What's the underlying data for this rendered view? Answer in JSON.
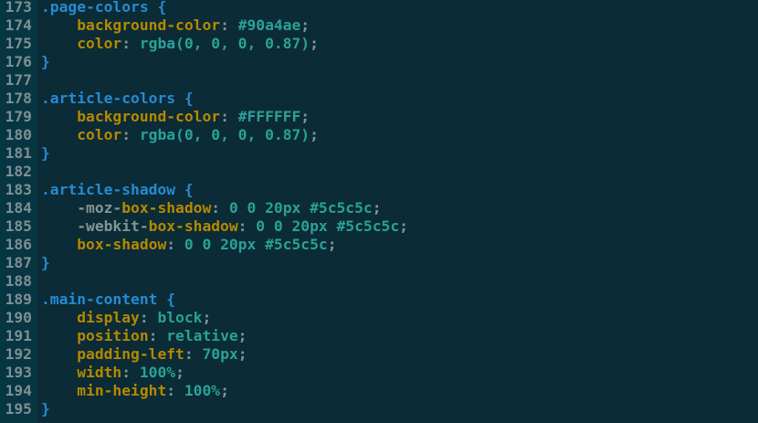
{
  "colors": {
    "background": "#0b2b36",
    "gutter": "#073642",
    "line_number": "#7f8f92",
    "selector": "#268bd2",
    "property": "#b58900",
    "value": "#2aa198",
    "punctuation": "#839496"
  },
  "editor": {
    "lines": [
      {
        "n": "173",
        "tokens": [
          {
            "t": "sel",
            "v": ".page-colors"
          },
          {
            "t": "brace",
            "v": " {"
          }
        ]
      },
      {
        "n": "174",
        "tokens": [
          {
            "t": "ind",
            "v": "    "
          },
          {
            "t": "prop",
            "v": "background-color"
          },
          {
            "t": "punct",
            "v": ": "
          },
          {
            "t": "val",
            "v": "#90a4ae"
          },
          {
            "t": "punct",
            "v": ";"
          }
        ]
      },
      {
        "n": "175",
        "tokens": [
          {
            "t": "ind",
            "v": "    "
          },
          {
            "t": "prop",
            "v": "color"
          },
          {
            "t": "punct",
            "v": ": "
          },
          {
            "t": "val",
            "v": "rgba(0, 0, 0, 0.87)"
          },
          {
            "t": "punct",
            "v": ";"
          }
        ]
      },
      {
        "n": "176",
        "tokens": [
          {
            "t": "brace",
            "v": "}"
          }
        ]
      },
      {
        "n": "177",
        "tokens": []
      },
      {
        "n": "178",
        "tokens": [
          {
            "t": "sel",
            "v": ".article-colors"
          },
          {
            "t": "brace",
            "v": " {"
          }
        ]
      },
      {
        "n": "179",
        "tokens": [
          {
            "t": "ind",
            "v": "    "
          },
          {
            "t": "prop",
            "v": "background-color"
          },
          {
            "t": "punct",
            "v": ": "
          },
          {
            "t": "val",
            "v": "#FFFFFF"
          },
          {
            "t": "punct",
            "v": ";"
          }
        ]
      },
      {
        "n": "180",
        "tokens": [
          {
            "t": "ind",
            "v": "    "
          },
          {
            "t": "prop",
            "v": "color"
          },
          {
            "t": "punct",
            "v": ": "
          },
          {
            "t": "val",
            "v": "rgba(0, 0, 0, 0.87)"
          },
          {
            "t": "punct",
            "v": ";"
          }
        ]
      },
      {
        "n": "181",
        "tokens": [
          {
            "t": "brace",
            "v": "}"
          }
        ]
      },
      {
        "n": "182",
        "tokens": []
      },
      {
        "n": "183",
        "tokens": [
          {
            "t": "sel",
            "v": ".article-shadow"
          },
          {
            "t": "brace",
            "v": " {"
          }
        ]
      },
      {
        "n": "184",
        "tokens": [
          {
            "t": "ind",
            "v": "    "
          },
          {
            "t": "vend",
            "v": "-moz-"
          },
          {
            "t": "prop",
            "v": "box-shadow"
          },
          {
            "t": "punct",
            "v": ": "
          },
          {
            "t": "val",
            "v": "0 0 20px #5c5c5c"
          },
          {
            "t": "punct",
            "v": ";"
          }
        ]
      },
      {
        "n": "185",
        "tokens": [
          {
            "t": "ind",
            "v": "    "
          },
          {
            "t": "vend",
            "v": "-webkit-"
          },
          {
            "t": "prop",
            "v": "box-shadow"
          },
          {
            "t": "punct",
            "v": ": "
          },
          {
            "t": "val",
            "v": "0 0 20px #5c5c5c"
          },
          {
            "t": "punct",
            "v": ";"
          }
        ]
      },
      {
        "n": "186",
        "tokens": [
          {
            "t": "ind",
            "v": "    "
          },
          {
            "t": "prop",
            "v": "box-shadow"
          },
          {
            "t": "punct",
            "v": ": "
          },
          {
            "t": "val",
            "v": "0 0 20px #5c5c5c"
          },
          {
            "t": "punct",
            "v": ";"
          }
        ]
      },
      {
        "n": "187",
        "tokens": [
          {
            "t": "brace",
            "v": "}"
          }
        ]
      },
      {
        "n": "188",
        "tokens": []
      },
      {
        "n": "189",
        "tokens": [
          {
            "t": "sel",
            "v": ".main-content"
          },
          {
            "t": "brace",
            "v": " {"
          }
        ]
      },
      {
        "n": "190",
        "tokens": [
          {
            "t": "ind",
            "v": "    "
          },
          {
            "t": "prop",
            "v": "display"
          },
          {
            "t": "punct",
            "v": ": "
          },
          {
            "t": "val",
            "v": "block"
          },
          {
            "t": "punct",
            "v": ";"
          }
        ]
      },
      {
        "n": "191",
        "tokens": [
          {
            "t": "ind",
            "v": "    "
          },
          {
            "t": "prop",
            "v": "position"
          },
          {
            "t": "punct",
            "v": ": "
          },
          {
            "t": "val",
            "v": "relative"
          },
          {
            "t": "punct",
            "v": ";"
          }
        ]
      },
      {
        "n": "192",
        "tokens": [
          {
            "t": "ind",
            "v": "    "
          },
          {
            "t": "prop",
            "v": "padding-left"
          },
          {
            "t": "punct",
            "v": ": "
          },
          {
            "t": "val",
            "v": "70px"
          },
          {
            "t": "punct",
            "v": ";"
          }
        ]
      },
      {
        "n": "193",
        "tokens": [
          {
            "t": "ind",
            "v": "    "
          },
          {
            "t": "prop",
            "v": "width"
          },
          {
            "t": "punct",
            "v": ": "
          },
          {
            "t": "val",
            "v": "100%"
          },
          {
            "t": "punct",
            "v": ";"
          }
        ]
      },
      {
        "n": "194",
        "tokens": [
          {
            "t": "ind",
            "v": "    "
          },
          {
            "t": "prop",
            "v": "min-height"
          },
          {
            "t": "punct",
            "v": ": "
          },
          {
            "t": "val",
            "v": "100%"
          },
          {
            "t": "punct",
            "v": ";"
          }
        ]
      },
      {
        "n": "195",
        "tokens": [
          {
            "t": "brace",
            "v": "}"
          }
        ]
      }
    ]
  }
}
